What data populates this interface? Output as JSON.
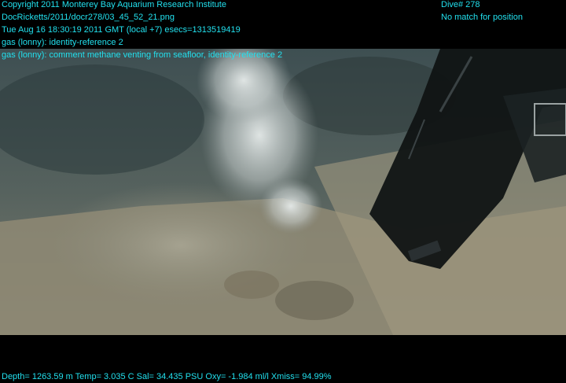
{
  "header": {
    "lines": [
      "Copyright 2011 Monterey Bay Aquarium Research Institute",
      "DocRicketts/2011/docr278/03_45_52_21.png",
      "Tue Aug 16 18:30:19 2011 GMT (local +7)  esecs=1313519419",
      "gas (lonny): identity-reference 2",
      "gas (lonny): comment methane venting from seafloor, identity-reference 2"
    ],
    "dive": "Dive# 278",
    "position_status": "No match for position"
  },
  "footer": {
    "telemetry": "Depth= 1263.59 m  Temp= 3.035 C  Sal= 34.435 PSU  Oxy= -1.984 ml/l  Xmiss= 94.99%"
  },
  "colors": {
    "overlay_text": "#22e0ee",
    "background": "#000000"
  }
}
